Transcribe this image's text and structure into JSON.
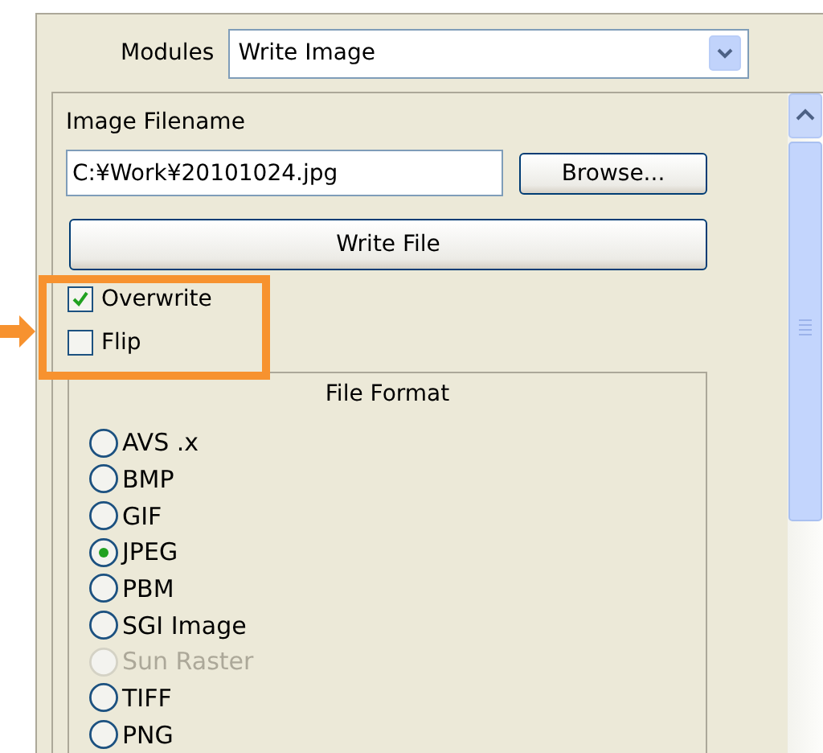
{
  "modules": {
    "label": "Modules",
    "value": "Write Image"
  },
  "image_filename": {
    "label": "Image Filename",
    "value": "C:¥Work¥20101024.jpg",
    "browse_button": "Browse..."
  },
  "write_button": "Write File",
  "checkboxes": [
    {
      "label": "Overwrite",
      "checked": true
    },
    {
      "label": "Flip",
      "checked": false
    }
  ],
  "file_format": {
    "title": "File Format",
    "options": [
      {
        "label": "AVS .x",
        "selected": false,
        "disabled": false
      },
      {
        "label": "BMP",
        "selected": false,
        "disabled": false
      },
      {
        "label": "GIF",
        "selected": false,
        "disabled": false
      },
      {
        "label": "JPEG",
        "selected": true,
        "disabled": false
      },
      {
        "label": "PBM",
        "selected": false,
        "disabled": false
      },
      {
        "label": "SGI Image",
        "selected": false,
        "disabled": false
      },
      {
        "label": "Sun Raster",
        "selected": false,
        "disabled": true
      },
      {
        "label": "TIFF",
        "selected": false,
        "disabled": false
      },
      {
        "label": "PNG",
        "selected": false,
        "disabled": false
      }
    ]
  }
}
